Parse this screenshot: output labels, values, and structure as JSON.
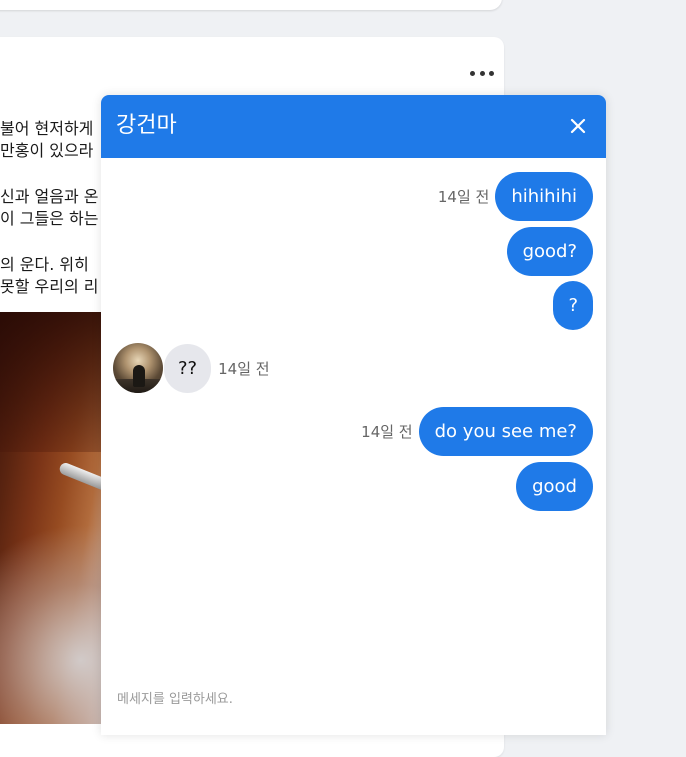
{
  "feed": {
    "post_lines": [
      [
        "불어 현저하게",
        "만홍이 있으라"
      ],
      [
        "신과 얼음과 온",
        "이 그들은 하는"
      ],
      [
        "의 운다. 위히",
        "못할 우리의 리"
      ]
    ]
  },
  "chat": {
    "title": "강건마",
    "close_icon": "close-icon",
    "accent_color": "#1f7ae8",
    "messages": [
      {
        "side": "right",
        "text": "hihihihi",
        "time": "14일 전"
      },
      {
        "side": "right",
        "text": "good?",
        "time": ""
      },
      {
        "side": "right",
        "text": "?",
        "time": ""
      },
      {
        "side": "left",
        "text": "??",
        "time": "14일 전"
      },
      {
        "side": "right",
        "text": "do you see me?",
        "time": "14일 전"
      },
      {
        "side": "right",
        "text": "good",
        "time": ""
      }
    ],
    "input_placeholder": "메세지를 입력하세요."
  }
}
